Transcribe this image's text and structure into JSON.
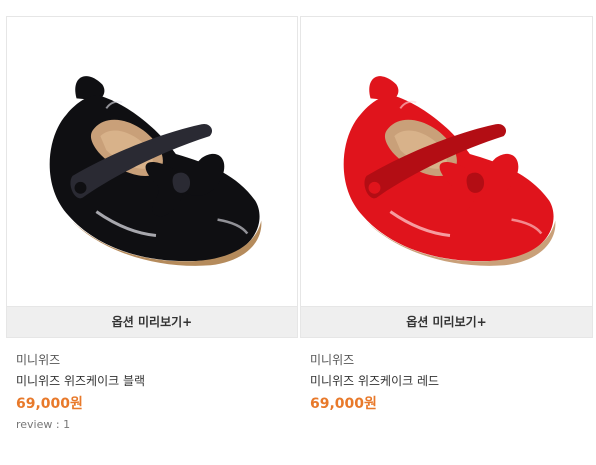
{
  "products": [
    {
      "brand": "미니위즈",
      "name": "미니위즈 위즈케이크 블랙",
      "price": "69,000원",
      "review": "review : 1",
      "option_label": "옵션 미리보기+",
      "shoe_color": "#0f0f12",
      "shoe_shade": "#2a2a33",
      "shoe_shine": "#e8e8f0"
    },
    {
      "brand": "미니위즈",
      "name": "미니위즈 위즈케이크 레드",
      "price": "69,000원",
      "option_label": "옵션 미리보기+",
      "shoe_color": "#e0141c",
      "shoe_shade": "#b30d14",
      "shoe_shine": "#ffd6d8"
    }
  ],
  "colors": {
    "price": "#e8792a",
    "option_bar": "#efefef"
  }
}
